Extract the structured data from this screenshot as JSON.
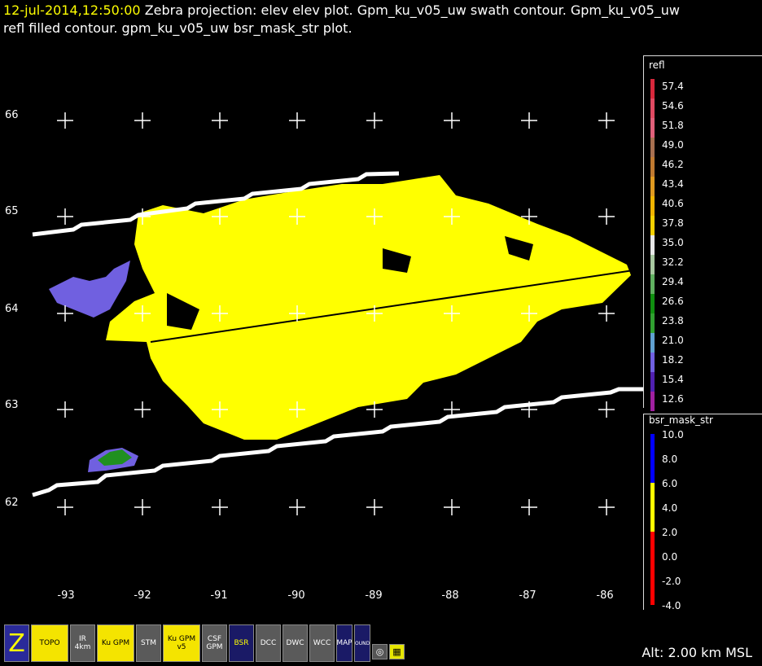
{
  "title": {
    "time": "12-jul-2014,12:50:00",
    "line1": "Zebra projection: elev elev  plot.  Gpm_ku_v05_uw swath contour.  Gpm_ku_v05_uw",
    "line2": "refl filled contour.  gpm_ku_v05_uw bsr_mask_str  plot."
  },
  "lat_labels": [
    "66",
    "65",
    "64",
    "63",
    "62"
  ],
  "lon_labels": [
    "-93",
    "-92",
    "-91",
    "-90",
    "-89",
    "-88",
    "-87",
    "-86"
  ],
  "legend_refl": {
    "title": "refl",
    "labels": [
      "57.4",
      "54.6",
      "51.8",
      "49.0",
      "46.2",
      "43.4",
      "40.6",
      "37.8",
      "35.0",
      "32.2",
      "29.4",
      "26.6",
      "23.8",
      "21.0",
      "18.2",
      "15.4",
      "12.6"
    ],
    "colors": [
      "#d8283c",
      "#e04a62",
      "#e0607a",
      "#a87050",
      "#c07a30",
      "#e09a20",
      "#f0b400",
      "#f4d000",
      "#e8e8e8",
      "#a8c8a0",
      "#60b060",
      "#109010",
      "#30a030",
      "#60a0d0",
      "#7060e0",
      "#5020b0",
      "#a020a0"
    ]
  },
  "legend_mask": {
    "title": "bsr_mask_str",
    "labels": [
      "10.0",
      "8.0",
      "6.0",
      "4.0",
      "2.0",
      "0.0",
      "-2.0",
      "-4.0"
    ],
    "colors": [
      "#0000ff",
      "#0000ff",
      "#ffff00",
      "#ffff00",
      "#ff0000",
      "#ff0000",
      "#ff0000"
    ]
  },
  "icons": [
    {
      "name": "zebra-logo-icon",
      "label": "Z"
    },
    {
      "name": "topo-icon",
      "label": "TOPO"
    },
    {
      "name": "ir-4km-icon",
      "label": "IR 4km"
    },
    {
      "name": "ku-gpm-icon",
      "label": "Ku GPM"
    },
    {
      "name": "stm-icon",
      "label": "STM"
    },
    {
      "name": "ku-gpm-v5-icon",
      "label": "Ku GPM v5"
    },
    {
      "name": "csf-gpm-icon",
      "label": "CSF GPM"
    },
    {
      "name": "bsr-icon",
      "label": "BSR"
    },
    {
      "name": "dcc-icon",
      "label": "DCC"
    },
    {
      "name": "dwc-icon",
      "label": "DWC"
    },
    {
      "name": "wcc-icon",
      "label": "WCC"
    },
    {
      "name": "map-icon",
      "label": "MAP"
    },
    {
      "name": "bounds-icon",
      "label": "BOUNDS"
    }
  ],
  "altitude": "Alt: 2.00 km MSL"
}
